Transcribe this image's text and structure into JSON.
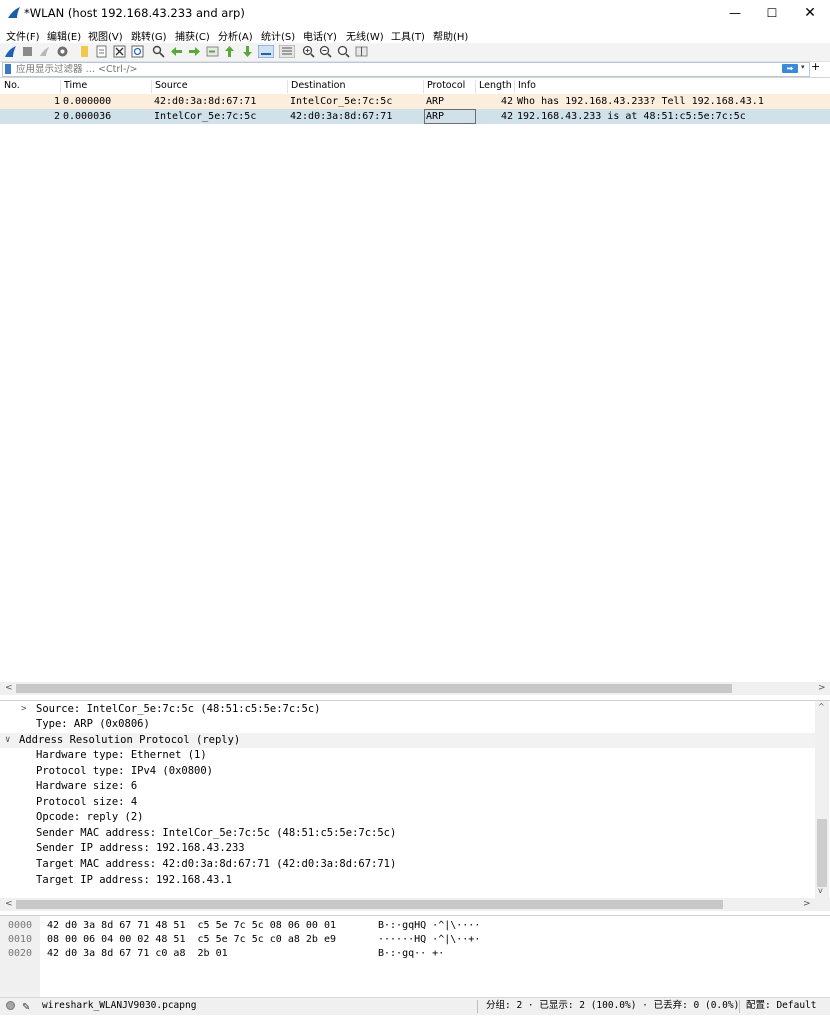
{
  "window": {
    "title": "*WLAN (host 192.168.43.233 and arp)",
    "min_glyph": "—",
    "max_glyph": "☐",
    "close_glyph": "✕"
  },
  "menu": [
    "文件(F)",
    "编辑(E)",
    "视图(V)",
    "跳转(G)",
    "捕获(C)",
    "分析(A)",
    "统计(S)",
    "电话(Y)",
    "无线(W)",
    "工具(T)",
    "帮助(H)"
  ],
  "toolbar_icons": [
    "start-capture-icon",
    "stop-capture-icon",
    "restart-capture-icon",
    "capture-options-icon",
    "open-file-icon",
    "save-file-icon",
    "close-file-icon",
    "reload-file-icon",
    "find-packet-icon",
    "go-back-icon",
    "go-forward-icon",
    "go-to-packet-icon",
    "go-first-icon",
    "go-last-icon",
    "auto-scroll-icon",
    "colorize-icon",
    "zoom-in-icon",
    "zoom-out-icon",
    "zoom-normal-icon",
    "resize-columns-icon"
  ],
  "filter": {
    "placeholder": "应用显示过滤器 … <Ctrl-/>",
    "apply_glyph": "➡",
    "dropdown_glyph": "▾",
    "add_glyph": "+"
  },
  "packet_list": {
    "columns": [
      "No.",
      "Time",
      "Source",
      "Destination",
      "Protocol",
      "Length",
      "Info"
    ],
    "rows": [
      {
        "no": "1",
        "time": "0.000000",
        "source": "42:d0:3a:8d:67:71",
        "destination": "IntelCor_5e:7c:5c",
        "protocol": "ARP",
        "length": "42",
        "info": "Who has 192.168.43.233? Tell 192.168.43.1"
      },
      {
        "no": "2",
        "time": "0.000036",
        "source": "IntelCor_5e:7c:5c",
        "destination": "42:d0:3a:8d:67:71",
        "protocol": "ARP",
        "length": "42",
        "info": "192.168.43.233 is at 48:51:c5:5e:7c:5c"
      }
    ],
    "selected_row": 2
  },
  "details": [
    {
      "expander": ">",
      "text": "Source: IntelCor_5e:7c:5c (48:51:c5:5e:7c:5c)"
    },
    {
      "expander": "",
      "text": "Type: ARP (0x0806)"
    },
    {
      "expander": "∨",
      "text": "Address Resolution Protocol (reply)"
    },
    {
      "expander": "",
      "text": "Hardware type: Ethernet (1)"
    },
    {
      "expander": "",
      "text": "Protocol type: IPv4 (0x0800)"
    },
    {
      "expander": "",
      "text": "Hardware size: 6"
    },
    {
      "expander": "",
      "text": "Protocol size: 4"
    },
    {
      "expander": "",
      "text": "Opcode: reply (2)"
    },
    {
      "expander": "",
      "text": "Sender MAC address: IntelCor_5e:7c:5c (48:51:c5:5e:7c:5c)"
    },
    {
      "expander": "",
      "text": "Sender IP address: 192.168.43.233"
    },
    {
      "expander": "",
      "text": "Target MAC address: 42:d0:3a:8d:67:71 (42:d0:3a:8d:67:71)"
    },
    {
      "expander": "",
      "text": "Target IP address: 192.168.43.1"
    }
  ],
  "bytes": [
    {
      "offset": "0000",
      "hex": "42 d0 3a 8d 67 71 48 51  c5 5e 7c 5c 08 06 00 01",
      "ascii": "B·:·gqHQ ·^|\\····"
    },
    {
      "offset": "0010",
      "hex": "08 00 06 04 00 02 48 51  c5 5e 7c 5c c0 a8 2b e9",
      "ascii": "······HQ ·^|\\··+·"
    },
    {
      "offset": "0020",
      "hex": "42 d0 3a 8d 67 71 c0 a8  2b 01",
      "ascii": "B·:·gq·· +·"
    }
  ],
  "status": {
    "file": "wireshark_WLANJV9030.pcapng",
    "packets": "分组: 2 · 已显示: 2 (100.0%) · 已丢弃: 0 (0.0%)",
    "profile": "配置: Default"
  },
  "scroll_glyphs": {
    "left": "<",
    "right": ">",
    "up": "^",
    "down": "v"
  },
  "colors": {
    "row_1_bg": "#fbeedd",
    "row_2_selected_bg": "#d0e1ea",
    "accent": "#3a78c4"
  }
}
